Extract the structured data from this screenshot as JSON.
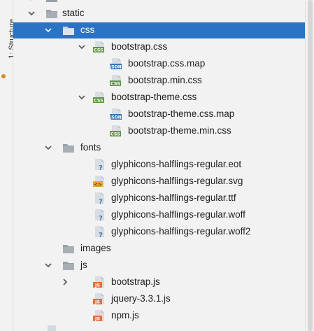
{
  "side_tab": {
    "label": "1: Structure"
  },
  "tree": {
    "rows": [
      {
        "label": "bootstrap.css",
        "name": "bootstrap-css",
        "icon": "css-file-icon"
      },
      {
        "label": "bootstrap.css.map",
        "name": "bootstrap-css-map",
        "icon": "json-file-icon"
      },
      {
        "label": "bootstrap.min.css",
        "name": "bootstrap-min-css",
        "icon": "css-file-icon"
      },
      {
        "label": "bootstrap-theme.css",
        "name": "bootstrap-theme-css",
        "icon": "css-file-icon"
      },
      {
        "label": "bootstrap-theme.css.map",
        "name": "bootstrap-theme-css-map",
        "icon": "json-file-icon"
      },
      {
        "label": "bootstrap-theme.min.css",
        "name": "bootstrap-theme-min-css",
        "icon": "css-file-icon"
      },
      {
        "label": "fonts",
        "name": "folder-fonts",
        "icon": "folder-icon"
      },
      {
        "label": "glyphicons-halflings-regular.eot",
        "name": "glyphicons-eot",
        "icon": "unknown-file-icon"
      },
      {
        "label": "glyphicons-halflings-regular.svg",
        "name": "glyphicons-svg",
        "icon": "svg-file-icon"
      },
      {
        "label": "glyphicons-halflings-regular.ttf",
        "name": "glyphicons-ttf",
        "icon": "unknown-file-icon"
      },
      {
        "label": "glyphicons-halflings-regular.woff",
        "name": "glyphicons-woff",
        "icon": "unknown-file-icon"
      },
      {
        "label": "glyphicons-halflings-regular.woff2",
        "name": "glyphicons-woff2",
        "icon": "unknown-file-icon"
      },
      {
        "label": "images",
        "name": "folder-images",
        "icon": "folder-icon"
      },
      {
        "label": "js",
        "name": "folder-js",
        "icon": "folder-icon"
      },
      {
        "label": "bootstrap.js",
        "name": "bootstrap-js",
        "icon": "js-file-icon"
      },
      {
        "label": "jquery-3.3.1.js",
        "name": "jquery-js",
        "icon": "js-file-icon"
      },
      {
        "label": "npm.js",
        "name": "npm-js",
        "icon": "js-file-icon"
      }
    ],
    "static": {
      "label": "static",
      "icon": "folder-icon"
    },
    "css": {
      "label": "css",
      "icon": "folder-icon"
    }
  },
  "colors": {
    "selection": "#2b73c4",
    "css_badge": "#5b9a3a",
    "json_badge": "#3a78b5",
    "js_badge": "#e0703c",
    "svg_badge": "#e8a33a",
    "folder": "#8a9099"
  }
}
